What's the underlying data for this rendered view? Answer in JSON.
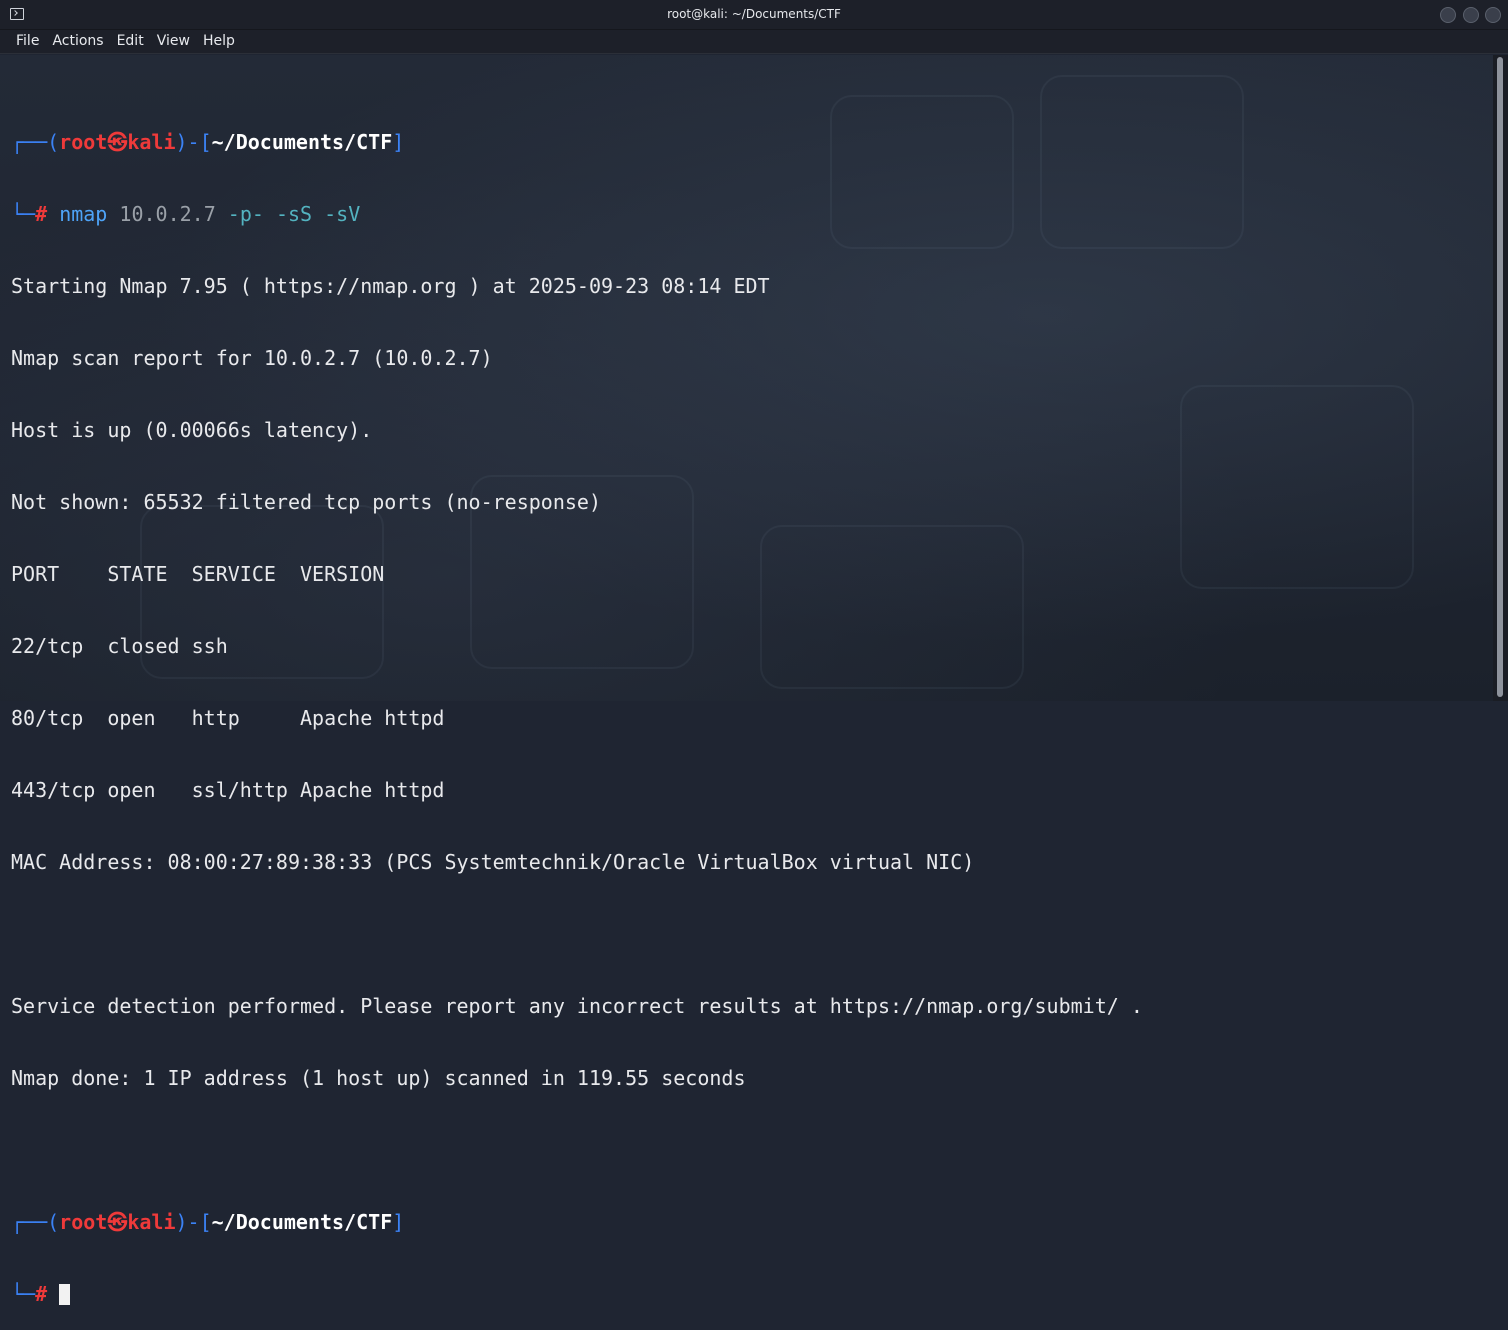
{
  "window": {
    "title": "root@kali: ~/Documents/CTF"
  },
  "menu": [
    "File",
    "Actions",
    "Edit",
    "View",
    "Help"
  ],
  "prompt": {
    "corner_top": "┌──(",
    "user": "root",
    "at_symbol": "㉿",
    "host": "kali",
    "mid": ")-[",
    "path": "~/Documents/CTF",
    "close": "]",
    "corner_bottom": "└─",
    "hash": "#"
  },
  "command": {
    "name": "nmap",
    "target": "10.0.2.7",
    "options": "-p- -sS -sV"
  },
  "output": [
    "Starting Nmap 7.95 ( https://nmap.org ) at 2025-09-23 08:14 EDT",
    "Nmap scan report for 10.0.2.7 (10.0.2.7)",
    "Host is up (0.00066s latency).",
    "Not shown: 65532 filtered tcp ports (no-response)",
    "PORT    STATE  SERVICE  VERSION",
    "22/tcp  closed ssh",
    "80/tcp  open   http     Apache httpd",
    "443/tcp open   ssl/http Apache httpd",
    "MAC Address: 08:00:27:89:38:33 (PCS Systemtechnik/Oracle VirtualBox virtual NIC)",
    "",
    "Service detection performed. Please report any incorrect results at https://nmap.org/submit/ .",
    "Nmap done: 1 IP address (1 host up) scanned in 119.55 seconds",
    ""
  ],
  "colors": {
    "prompt_frame": "#3b82f6",
    "prompt_user": "#ef3a3a",
    "command": "#4ea3f7",
    "option": "#53b3c0"
  }
}
